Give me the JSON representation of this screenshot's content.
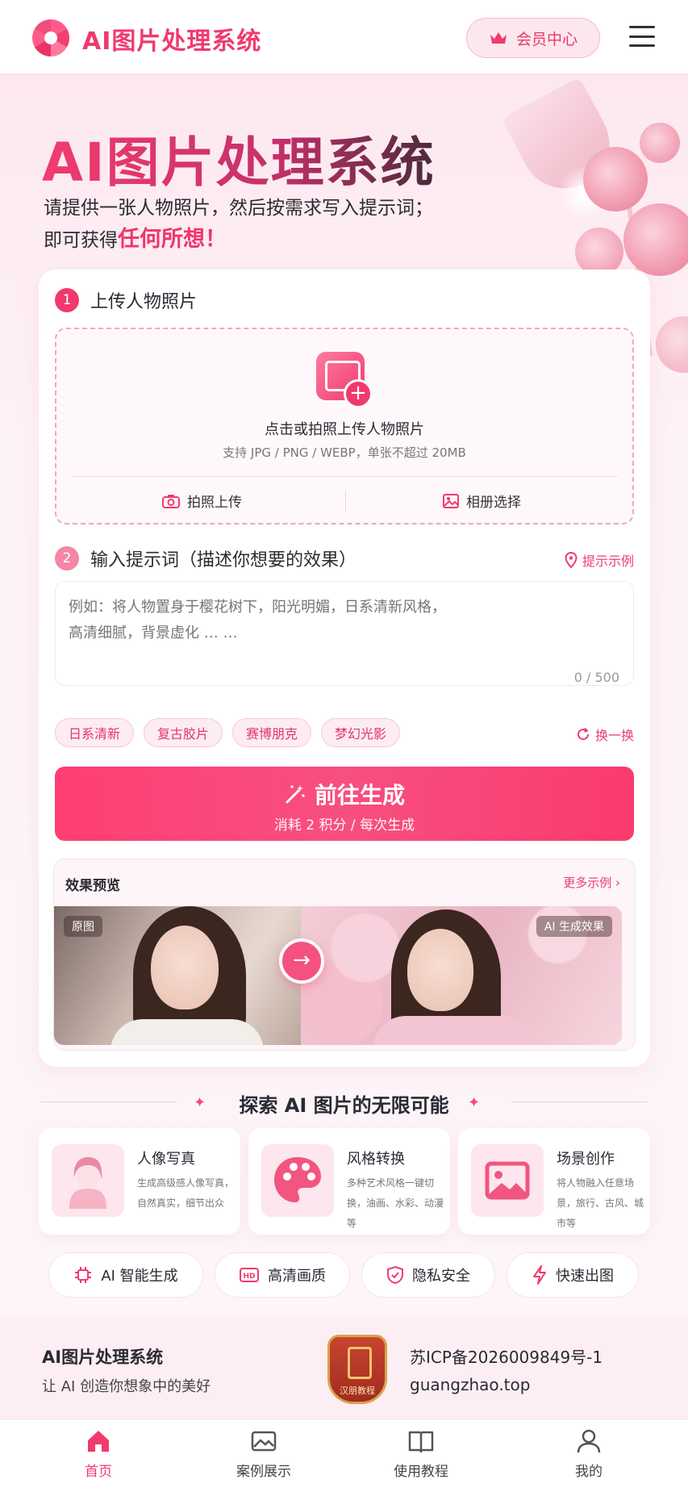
{
  "colors": {
    "accent": "#ef3b6e",
    "accent_light": "#fde7ee",
    "text": "#2a2a33"
  },
  "header": {
    "brand": "AI图片处理系统",
    "vip_label": "会员中心",
    "vip_icon": "crown-icon",
    "menu_icon": "menu-icon"
  },
  "hero": {
    "title": "AI图片处理系统",
    "subtitle_line1": "请提供一张人物照片，然后按需求写入提示词；",
    "subtitle_line2_prefix": "即可获得",
    "subtitle_line2_highlight": "任何所想！"
  },
  "upload": {
    "step_number": "1",
    "step_title": "上传人物照片",
    "main_text": "点击或拍照上传人物照片",
    "hint": "支持 JPG / PNG / WEBP，单张不超过 20MB",
    "camera_label": "拍照上传",
    "album_label": "相册选择"
  },
  "prompt": {
    "step_number": "2",
    "step_title": "输入提示词（描述你想要的效果）",
    "example_link": "提示示例",
    "placeholder": "例如：将人物置身于樱花树下，阳光明媚，日系清新风格，\n高清细腻，背景虚化 … …",
    "counter": "0 / 500",
    "tags": [
      "日系清新",
      "复古胶片",
      "赛博朋克",
      "梦幻光影"
    ],
    "swap_label": "换一换"
  },
  "generate": {
    "title": "前往生成",
    "subtitle": "消耗 2 积分 / 每次生成"
  },
  "preview": {
    "title": "效果预览",
    "more": "更多示例",
    "original_badge": "原图",
    "result_badge": "AI 生成效果"
  },
  "explore": {
    "title": "探索 AI 图片的无限可能",
    "features": [
      {
        "name": "人像写真",
        "desc": "生成高级感人像写真，自然真实，细节出众",
        "icon": "portrait-icon"
      },
      {
        "name": "风格转换",
        "desc": "多种艺术风格一键切换，油画、水彩、动漫等",
        "icon": "palette-icon"
      },
      {
        "name": "场景创作",
        "desc": "将人物融入任意场景，旅行、古风、城市等",
        "icon": "image-scene-icon"
      }
    ],
    "pills": [
      {
        "label": "AI 智能生成",
        "icon": "chip-icon"
      },
      {
        "label": "高清画质",
        "icon": "hd-icon"
      },
      {
        "label": "隐私安全",
        "icon": "shield-icon"
      },
      {
        "label": "快速出图",
        "icon": "lightning-icon"
      }
    ]
  },
  "footer": {
    "name": "AI图片处理系统",
    "slogan": "让 AI 创造你想象中的美好",
    "seal_text": "汉朋教程",
    "icp": "苏ICP备2026009849号-1",
    "domain": "guangzhao.top"
  },
  "bottom_nav": [
    {
      "label": "首页",
      "icon": "home-icon",
      "active": true
    },
    {
      "label": "案例展示",
      "icon": "gallery-icon",
      "active": false
    },
    {
      "label": "使用教程",
      "icon": "book-icon",
      "active": false
    },
    {
      "label": "我的",
      "icon": "user-icon",
      "active": false
    }
  ]
}
